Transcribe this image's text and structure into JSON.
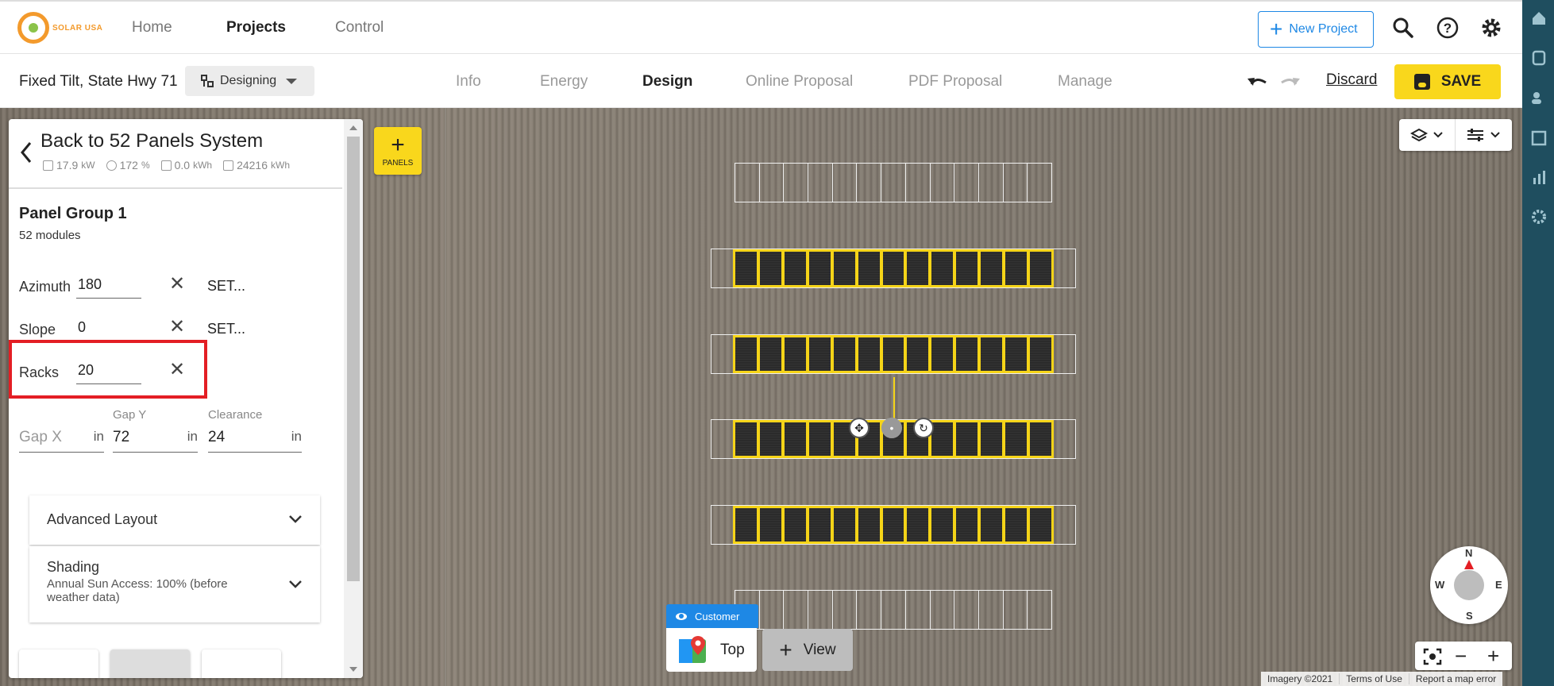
{
  "brand": {
    "logo_text": "SOLAR USA",
    "accent": "#f9d71c",
    "blue": "#1e88e5",
    "highlight": "#e31e24"
  },
  "topnav": {
    "items": [
      {
        "label": "Home",
        "active": false
      },
      {
        "label": "Projects",
        "active": true
      },
      {
        "label": "Control",
        "active": false
      }
    ],
    "new_project_label": "New Project",
    "icons": [
      "search-icon",
      "help-icon",
      "gear-icon"
    ]
  },
  "project": {
    "name": "Fixed Tilt, State Hwy 71",
    "status": "Designing"
  },
  "subtabs": [
    {
      "label": "Info",
      "active": false
    },
    {
      "label": "Energy",
      "active": false
    },
    {
      "label": "Design",
      "active": true
    },
    {
      "label": "Online Proposal",
      "active": false
    },
    {
      "label": "PDF Proposal",
      "active": false
    },
    {
      "label": "Manage",
      "active": false
    }
  ],
  "actions": {
    "discard_label": "Discard",
    "save_label": "SAVE"
  },
  "panel": {
    "back_title": "Back to 52 Panels System",
    "stats": [
      {
        "value": "17.9",
        "unit": "kW",
        "icon": "grid-icon"
      },
      {
        "value": "172",
        "unit": "%",
        "icon": "pie-icon"
      },
      {
        "value": "0.0",
        "unit": "kWh",
        "icon": "battery-icon"
      },
      {
        "value": "24216",
        "unit": "kWh",
        "icon": "energy-icon"
      }
    ],
    "group_title": "Panel Group 1",
    "group_sub": "52 modules",
    "azimuth": {
      "label": "Azimuth",
      "value": "180",
      "set_label": "SET..."
    },
    "slope": {
      "label": "Slope",
      "value": "0",
      "set_label": "SET..."
    },
    "racks": {
      "label": "Racks",
      "value": "20"
    },
    "gap_x": {
      "placeholder": "Gap X",
      "unit": "in"
    },
    "gap_y": {
      "label": "Gap Y",
      "value": "72",
      "unit": "in"
    },
    "clearance": {
      "label": "Clearance",
      "value": "24",
      "unit": "in"
    },
    "accordions": [
      {
        "title": "Advanced Layout"
      },
      {
        "title": "Shading",
        "subtitle": "Annual Sun Access: 100% (before weather data)"
      }
    ]
  },
  "map": {
    "add_panels_label": "PANELS",
    "customer_label": "Customer",
    "view_top_label": "Top",
    "view_label": "View",
    "compass": {
      "n": "N",
      "s": "S",
      "e": "E",
      "w": "W"
    },
    "attribution": [
      "Imagery ©2021",
      "Terms of Use",
      "Report a map error"
    ]
  }
}
